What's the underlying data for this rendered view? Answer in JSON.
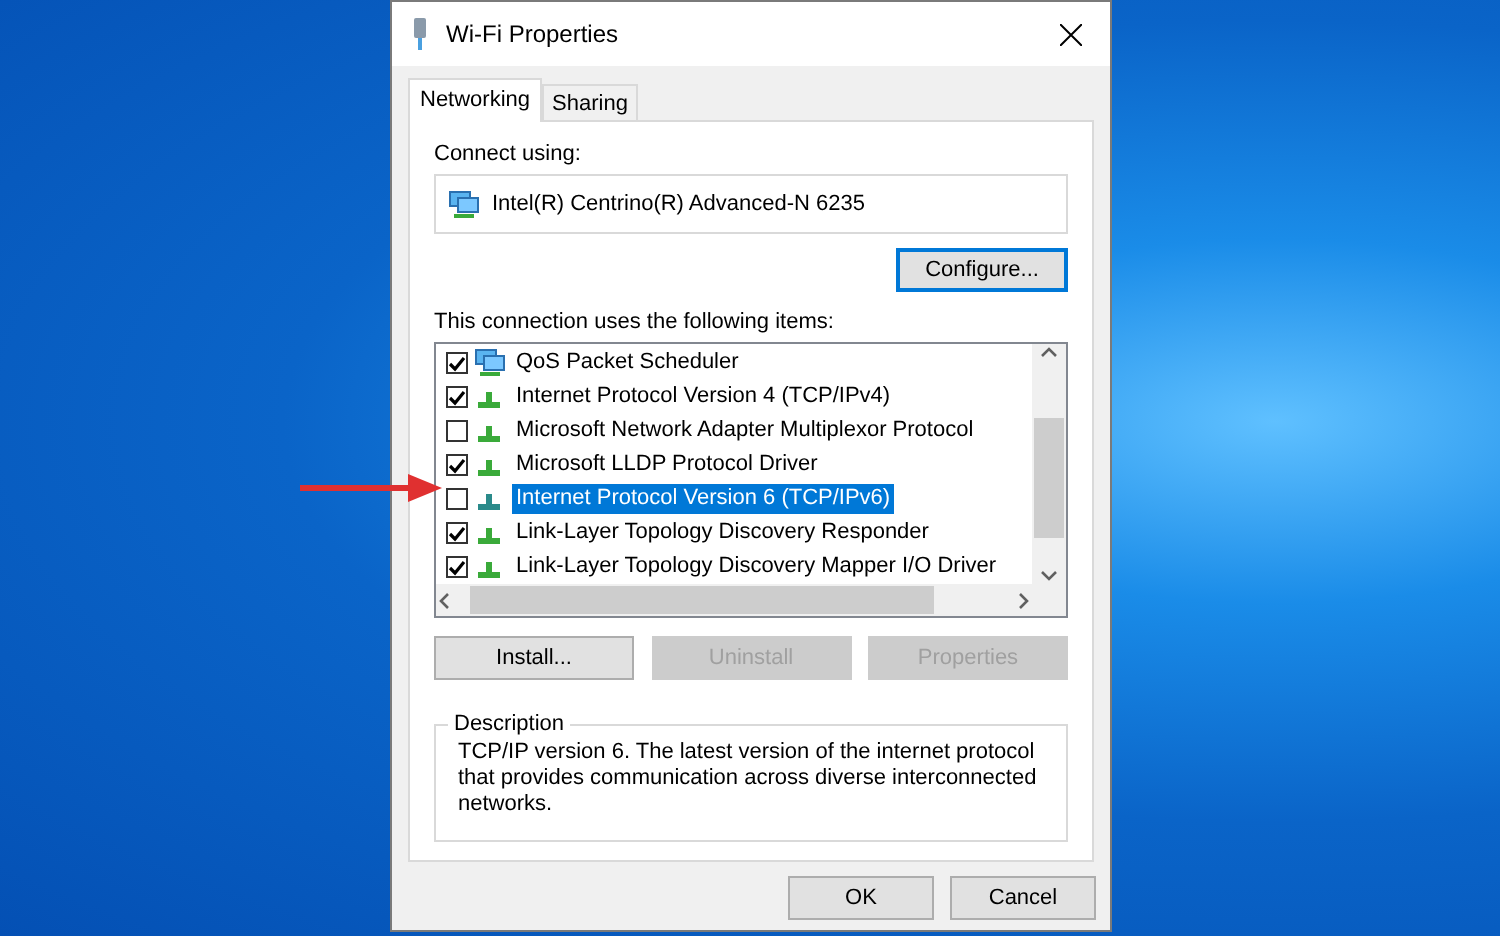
{
  "window": {
    "title": "Wi-Fi Properties"
  },
  "tabs": [
    {
      "label": "Networking",
      "selected": true
    },
    {
      "label": "Sharing",
      "selected": false
    }
  ],
  "connect_using": {
    "label": "Connect using:",
    "adapter": "Intel(R) Centrino(R) Advanced-N 6235"
  },
  "configure_button": "Configure...",
  "items_label": "This connection uses the following items:",
  "items": [
    {
      "label": "QoS Packet Scheduler",
      "kind": "service",
      "checked": true,
      "selected": false
    },
    {
      "label": "Internet Protocol Version 4 (TCP/IPv4)",
      "kind": "protocol",
      "checked": true,
      "selected": false
    },
    {
      "label": "Microsoft Network Adapter Multiplexor Protocol",
      "kind": "protocol",
      "checked": false,
      "selected": false
    },
    {
      "label": "Microsoft LLDP Protocol Driver",
      "kind": "protocol",
      "checked": true,
      "selected": false
    },
    {
      "label": "Internet Protocol Version 6 (TCP/IPv6)",
      "kind": "protocol",
      "checked": false,
      "selected": true
    },
    {
      "label": "Link-Layer Topology Discovery Responder",
      "kind": "protocol",
      "checked": true,
      "selected": false
    },
    {
      "label": "Link-Layer Topology Discovery Mapper I/O Driver",
      "kind": "protocol",
      "checked": true,
      "selected": false
    }
  ],
  "item_buttons": [
    {
      "label": "Install...",
      "disabled": false
    },
    {
      "label": "Uninstall",
      "disabled": true
    },
    {
      "label": "Properties",
      "disabled": true
    }
  ],
  "description": {
    "title": "Description",
    "text": "TCP/IP version 6. The latest version of the internet protocol that provides communication across diverse interconnected networks."
  },
  "dialog_buttons": [
    {
      "label": "OK"
    },
    {
      "label": "Cancel"
    }
  ]
}
